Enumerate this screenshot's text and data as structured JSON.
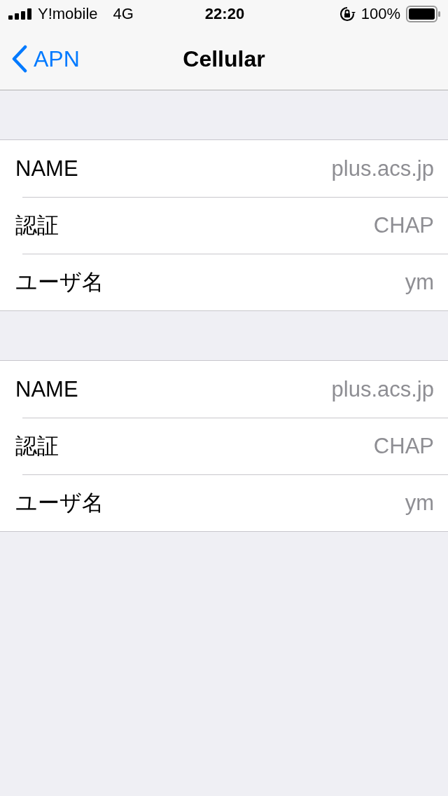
{
  "status_bar": {
    "carrier": "Y!mobile",
    "network": "4G",
    "time": "22:20",
    "battery": "100%"
  },
  "nav_bar": {
    "back": "APN",
    "title": "Cellular"
  },
  "sections": [
    {
      "rows": [
        {
          "label": "NAME",
          "value": "plus.acs.jp"
        },
        {
          "label": "認証",
          "value": "CHAP"
        },
        {
          "label": "ユーザ名",
          "value": "ym"
        }
      ]
    },
    {
      "rows": [
        {
          "label": "NAME",
          "value": "plus.acs.jp"
        },
        {
          "label": "認証",
          "value": "CHAP"
        },
        {
          "label": "ユーザ名",
          "value": "ym"
        }
      ]
    }
  ]
}
